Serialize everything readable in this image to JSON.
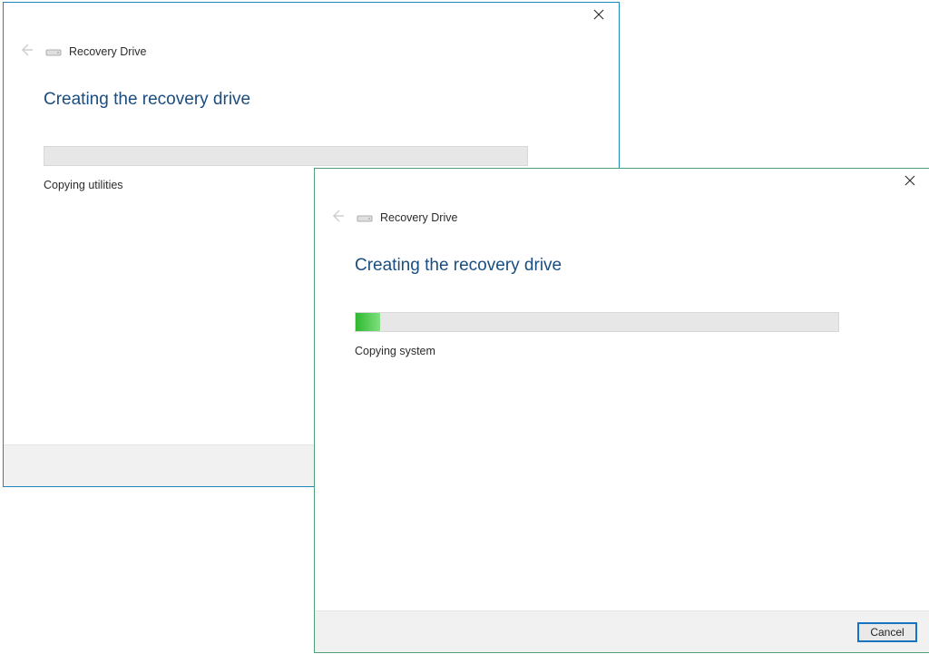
{
  "window_back": {
    "wizard_name": "Recovery Drive",
    "heading": "Creating the recovery drive",
    "status": "Copying utilities",
    "progress_percent": 0
  },
  "window_front": {
    "wizard_name": "Recovery Drive",
    "heading": "Creating the recovery drive",
    "status": "Copying system",
    "progress_percent": 5,
    "cancel_label": "Cancel"
  },
  "colors": {
    "border_blue": "#1d86bb",
    "border_green": "#4fa07a",
    "heading_blue": "#1a4d80",
    "progress_green_start": "#2eb82e",
    "progress_green_end": "#7fe07f"
  }
}
